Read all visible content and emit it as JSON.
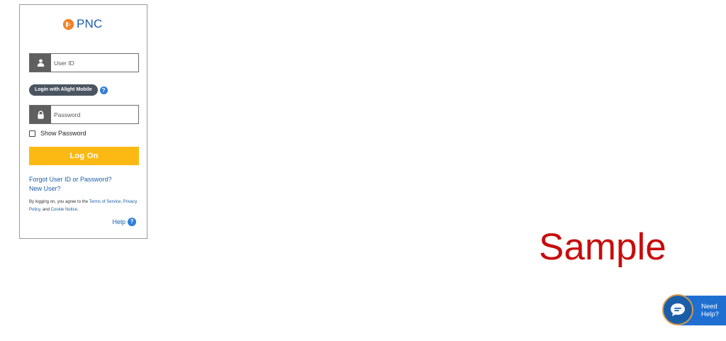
{
  "logo": {
    "text": "PNC",
    "brand_color": "#1b5ea8",
    "mark_color": "#f58025",
    "icon": "pnc-logo-icon"
  },
  "login": {
    "user_id_placeholder": "User ID",
    "user_icon": "user-icon",
    "alight_label": "Login with Alight Mobile",
    "alight_help_icon": "question-icon",
    "alight_help_glyph": "?",
    "password_placeholder": "Password",
    "lock_icon": "lock-icon",
    "show_password_label": "Show Password",
    "show_password_checked": false,
    "logon_label": "Log On",
    "logon_color": "#fdb913",
    "forgot_link": "Forgot User ID or Password?",
    "new_user_link": "New User?",
    "legal_prefix": "By logging on, you agree to the",
    "terms_link": "Terms of Service",
    "legal_comma": ",",
    "privacy_link": "Privacy Policy",
    "legal_and": ", and",
    "cookie_link": "Cookie Notice",
    "legal_end": ".",
    "help_label": "Help",
    "help_glyph": "?"
  },
  "watermark": {
    "text": "Sample",
    "color": "#c80c0c"
  },
  "chat": {
    "label_line1": "Need",
    "label_line2": "Help?",
    "icon": "chat-bubble-icon",
    "tab_color": "#1f6fd1"
  }
}
